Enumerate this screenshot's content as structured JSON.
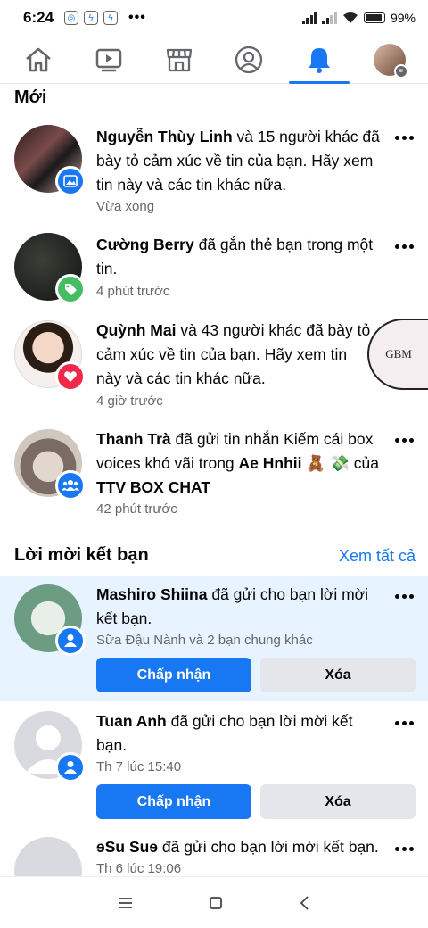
{
  "status": {
    "time": "6:24",
    "battery": "99%"
  },
  "sections": {
    "new": "Mới",
    "friend_requests": "Lời mời kết bạn",
    "see_all": "Xem tất cả"
  },
  "notifications": [
    {
      "name": "Nguyễn Thùy Linh",
      "text": " và 15 người khác đã bày tỏ cảm xúc về tin của bạn. Hãy xem tin này và các tin khác nữa.",
      "time": "Vừa xong"
    },
    {
      "name": "Cường Berry",
      "text": " đã gắn thẻ bạn trong một tin.",
      "time": "4 phút trước"
    },
    {
      "name": "Quỳnh Mai",
      "text": " và 43 người khác đã bày tỏ cảm xúc về tin của bạn. Hãy xem tin này và các tin khác nữa.",
      "time": "4 giờ trước"
    },
    {
      "name": "Thanh Trà",
      "text1": " đã gửi tin nhắn Kiếm cái box voices khó vãi trong ",
      "group": "Ae Hnhii",
      "emoji": "🧸 💸",
      "text2": " của ",
      "group2": "TTV BOX CHAT",
      "time": "42 phút trước"
    }
  ],
  "requests": [
    {
      "name": "Mashiro Shiina",
      "text": " đã gửi cho bạn lời mời kết bạn.",
      "mutual": "Sữa Đậu Nành và 2 bạn chung khác",
      "accept": "Chấp nhận",
      "delete": "Xóa"
    },
    {
      "name": "Tuan Anh",
      "text": " đã gửi cho bạn lời mời kết bạn.",
      "time": "Th 7 lúc 15:40",
      "accept": "Chấp nhận",
      "delete": "Xóa"
    },
    {
      "name": "ɘSu Suɘ",
      "text": " đã gửi cho bạn lời mời kết bạn.",
      "time": "Th 6 lúc 19:06"
    }
  ],
  "sticker_text": "GBM",
  "colors": {
    "accent": "#1877f2",
    "highlight": "#e7f3ff",
    "react_red": "#f02849",
    "tag_green": "#45bd62"
  },
  "icons": {
    "nav": [
      "home-icon",
      "watch-icon",
      "marketplace-icon",
      "profile-icon",
      "bell-icon",
      "menu-avatar"
    ],
    "system": [
      "recents-icon",
      "home-button-icon",
      "back-icon"
    ]
  }
}
